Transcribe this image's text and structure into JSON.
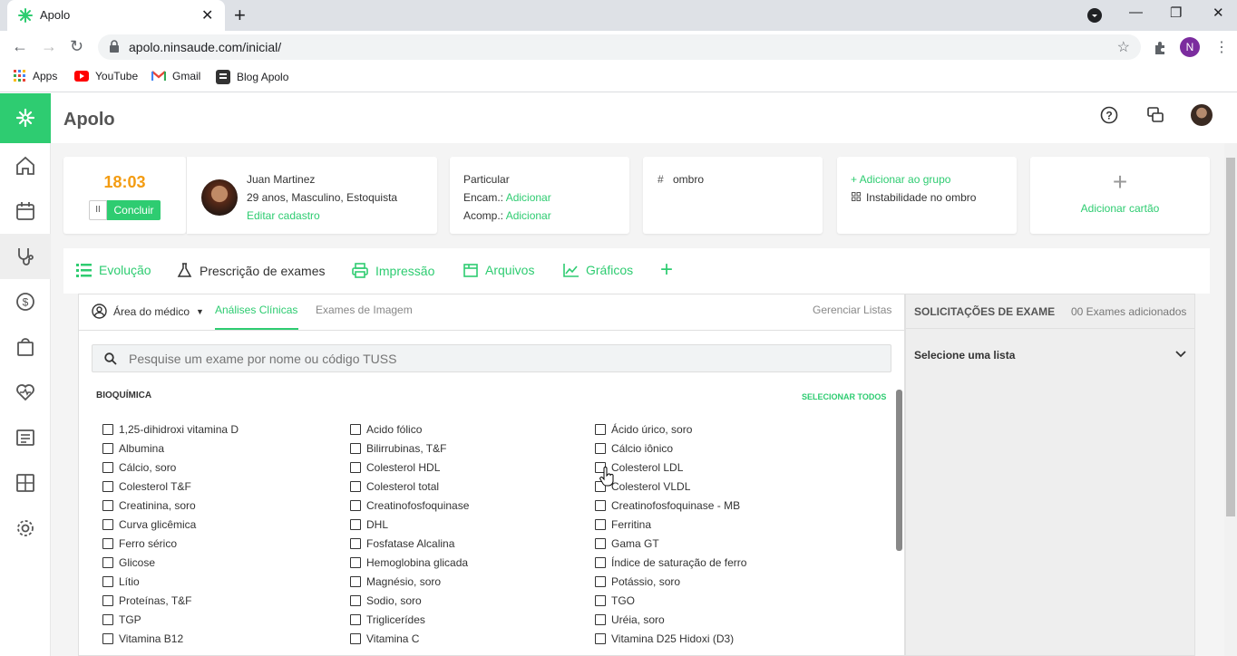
{
  "browser": {
    "tab_title": "Apolo",
    "url": "apolo.ninsaude.com/inicial/",
    "profile_initial": "N",
    "bookmarks": [
      "Apps",
      "YouTube",
      "Gmail",
      "Blog Apolo"
    ]
  },
  "app": {
    "title": "Apolo",
    "accent": "#2ecc71"
  },
  "timer": {
    "time": "18:03",
    "pause_icon": "II",
    "button": "Concluir"
  },
  "patient": {
    "name": "Juan Martinez",
    "details": "29 anos, Masculino, Estoquista",
    "edit_link": "Editar cadastro"
  },
  "insurance": {
    "plan": "Particular",
    "encam_label": "Encam.:",
    "encam_link": "Adicionar",
    "acomp_label": "Acomp.:",
    "acomp_link": "Adicionar"
  },
  "tag_card": {
    "symbol": "#",
    "tag": "ombro"
  },
  "group_card": {
    "add_link": "+ Adicionar ao grupo",
    "group": "Instabilidade no ombro"
  },
  "add_card": {
    "plus": "+",
    "label": "Adicionar cartão"
  },
  "tabs": [
    {
      "label": "Evolução"
    },
    {
      "label": "Prescrição de exames"
    },
    {
      "label": "Impressão"
    },
    {
      "label": "Arquivos"
    },
    {
      "label": "Gráficos"
    },
    {
      "label": "+"
    }
  ],
  "subtabs": {
    "area": "Área do médico",
    "analises": "Análises Clínicas",
    "imagem": "Exames de Imagem",
    "gerenciar": "Gerenciar Listas"
  },
  "search_placeholder": "Pesquise um exame por nome ou código TUSS",
  "section": {
    "title": "BIOQUÍMICA",
    "select_all": "SELECIONAR TODOS"
  },
  "exams": {
    "col1": [
      "1,25-dihidroxi vitamina D",
      "Albumina",
      "Cálcio, soro",
      "Colesterol T&F",
      "Creatinina, soro",
      "Curva glicêmica",
      "Ferro sérico",
      "Glicose",
      "Lítio",
      "Proteínas, T&F",
      "TGP",
      "Vitamina B12"
    ],
    "col2": [
      "Acido fólico",
      "Bilirrubinas, T&F",
      "Colesterol HDL",
      "Colesterol total",
      "Creatinofosfoquinase",
      "DHL",
      "Fosfatase Alcalina",
      "Hemoglobina glicada",
      "Magnésio, soro",
      "Sodio, soro",
      "Triglicerídes",
      "Vitamina C"
    ],
    "col3": [
      "Ácido úrico, soro",
      "Cálcio iônico",
      "Colesterol LDL",
      "Colesterol VLDL",
      "Creatinofosfoquinase - MB",
      "Ferritina",
      "Gama GT",
      "Índice de saturação de ferro",
      "Potássio, soro",
      "TGO",
      "Uréia, soro",
      "Vitamina D25 Hidoxi (D3)"
    ]
  },
  "requests": {
    "title": "SOLICITAÇÕES DE EXAME",
    "count": "00 Exames adicionados",
    "select": "Selecione uma lista"
  }
}
